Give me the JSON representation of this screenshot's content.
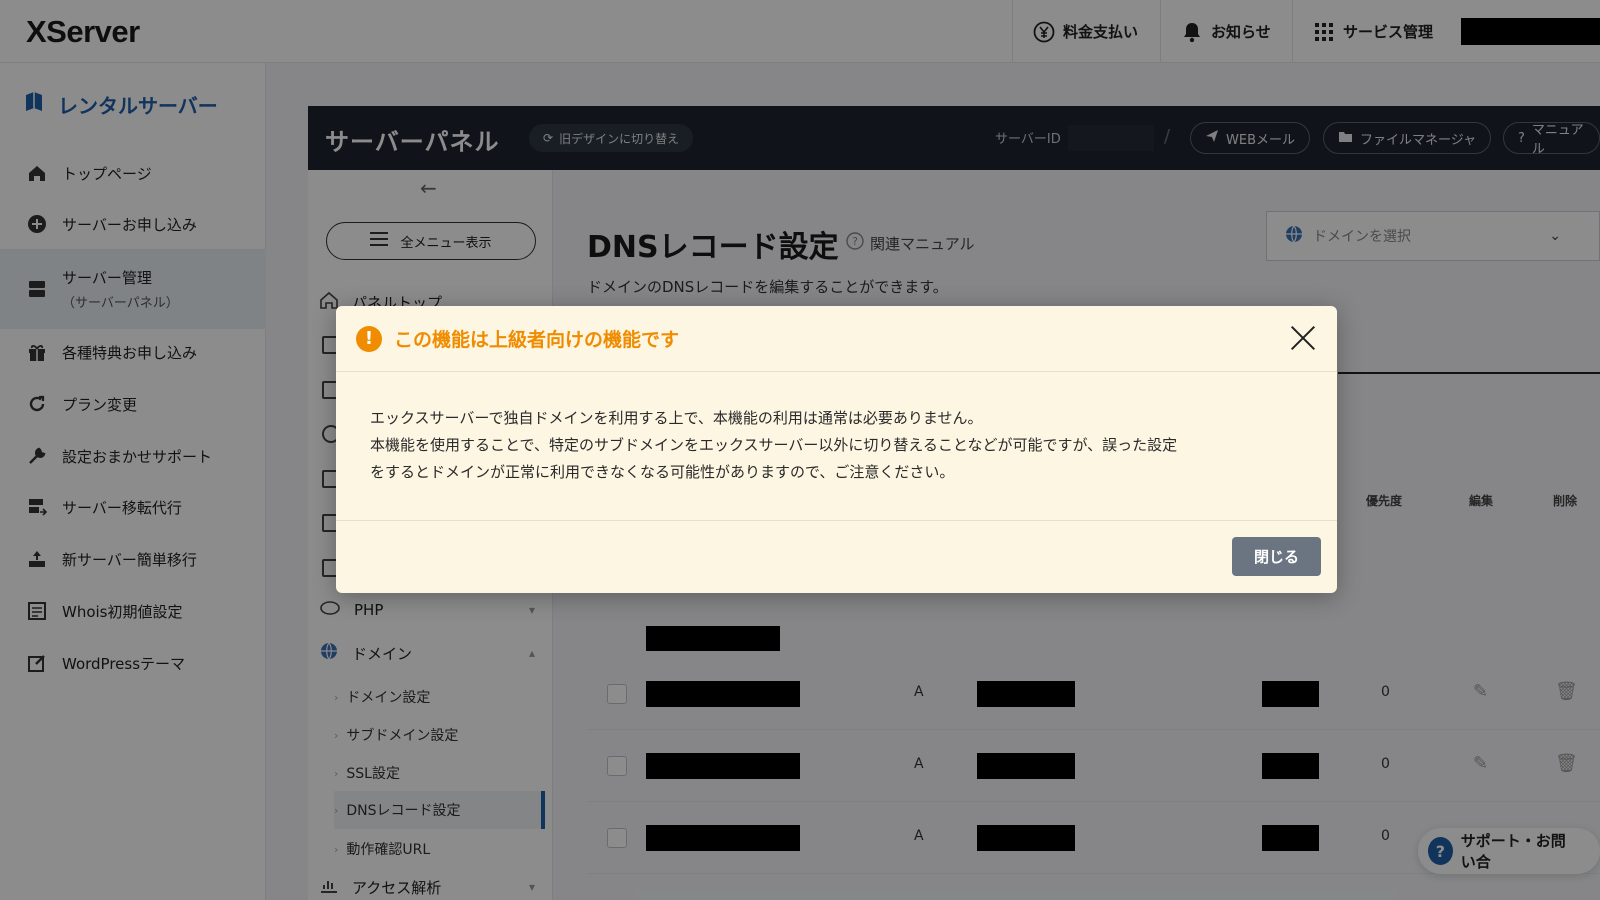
{
  "header": {
    "logo": "XServer",
    "nav": [
      {
        "label": "料金支払い",
        "icon": "yen-icon"
      },
      {
        "label": "お知らせ",
        "icon": "bell-icon"
      },
      {
        "label": "サービス管理",
        "icon": "grid-icon"
      }
    ]
  },
  "sidebar": {
    "title": "レンタルサーバー",
    "items": [
      {
        "label": "トップページ",
        "icon": "home-icon"
      },
      {
        "label": "サーバーお申し込み",
        "icon": "plus-circle-icon"
      },
      {
        "label": "サーバー管理",
        "sub": "（サーバーパネル）",
        "icon": "server-icon"
      },
      {
        "label": "各種特典お申し込み",
        "icon": "gift-icon"
      },
      {
        "label": "プラン変更",
        "icon": "refresh-icon"
      },
      {
        "label": "設定おまかせサポート",
        "icon": "wrench-icon"
      },
      {
        "label": "サーバー移転代行",
        "icon": "server-move-icon"
      },
      {
        "label": "新サーバー簡単移行",
        "icon": "upload-icon"
      },
      {
        "label": "Whois初期値設定",
        "icon": "list-icon"
      },
      {
        "label": "WordPressテーマ",
        "icon": "edit-icon"
      }
    ]
  },
  "panel": {
    "title": "サーバーパネル",
    "old_design": "旧デザインに切り替え",
    "server_id_label": "サーバーID",
    "buttons": [
      "WEBメール",
      "ファイルマネージャ",
      "マニュアル"
    ]
  },
  "menu": {
    "all_menu": "全メニュー表示",
    "panel_top": "パネルトップ",
    "php": "PHP",
    "domain": "ドメイン",
    "sub_items": [
      "ドメイン設定",
      "サブドメイン設定",
      "SSL設定",
      "DNSレコード設定",
      "動作確認URL"
    ],
    "access": "アクセス解析"
  },
  "main": {
    "title": "DNSレコード設定",
    "manual": "関連マニュアル",
    "description": "ドメインのDNSレコードを編集することができます。",
    "domain_placeholder": "ドメインを選択",
    "columns": {
      "priority": "優先度",
      "edit": "編集",
      "delete": "削除"
    },
    "rows": [
      {
        "type": "A",
        "priority": "0"
      },
      {
        "type": "A",
        "priority": "0"
      },
      {
        "type": "A",
        "priority": "0"
      }
    ]
  },
  "support": "サポート・お問い合",
  "modal": {
    "title": "この機能は上級者向けの機能です",
    "line1": "エックスサーバーで独自ドメインを利用する上で、本機能の利用は通常は必要ありません。",
    "line2": "本機能を使用することで、特定のサブドメインをエックスサーバー以外に切り替えることなどが可能ですが、誤った設定",
    "line3": "をするとドメインが正常に利用できなくなる可能性がありますので、ご注意ください。",
    "close_label": "閉じる"
  },
  "colors": {
    "warning": "#f08c00",
    "brand": "#1f5fa8",
    "panel_dark": "#1e2530"
  }
}
